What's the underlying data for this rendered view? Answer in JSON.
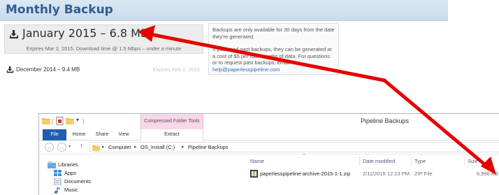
{
  "web": {
    "title": "Monthly Backup",
    "current": {
      "label": "January 2015 – 6.8 MB",
      "sub": "Expires Mar 2, 2015. Download time @ 1.5 Mbps – under a minute"
    },
    "previous": {
      "label": "December 2014 – 9.4 MB",
      "expires": "Expires Feb 2, 2015"
    },
    "info": {
      "p1": "Backups are only available for 30 days from the date they're generated.",
      "p2": "If you need past backups, they can be generated at a cost of $5 per four months of data. For questions or to request past backups, email",
      "email": "help@paperlesspipeline.com"
    }
  },
  "explorer": {
    "window_title": "Pipeline Backups",
    "context_tab": "Compressed Folder Tools",
    "tabs": [
      "File",
      "Home",
      "Share",
      "View"
    ],
    "extract_tab": "Extract",
    "breadcrumb": [
      "Computer",
      "OS_Install (C:)",
      "Pipeline Backups"
    ],
    "nav_items": [
      "Libraries",
      "Apps",
      "Documents",
      "Music"
    ],
    "columns": [
      "Name",
      "Date modified",
      "Type",
      "Size"
    ],
    "file": {
      "name": "paperlesspipeline-archive-2015-1-1.zip",
      "date": "2/11/2015 12:23 PM",
      "type": "ZIP File",
      "size": "6,996 KB"
    }
  },
  "colors": {
    "header_title": "#2f5e8e",
    "arrow": "#e60000",
    "file_tab": "#1f5fae",
    "context_tab": "#f7d7e8",
    "link": "#2f6db3"
  },
  "icons": {
    "download": "download-icon",
    "folder": "folder-icon",
    "zip": "zip-file-icon",
    "music": "music-icon"
  }
}
